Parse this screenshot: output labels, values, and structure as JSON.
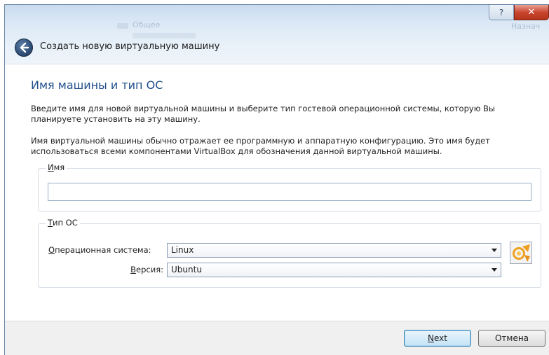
{
  "window": {
    "title": "Создать новую виртуальную машину",
    "help_label": "?",
    "close_label": "✕"
  },
  "background_hints": {
    "left_item": "Общее",
    "right_item": "Назнач"
  },
  "page": {
    "heading": "Имя машины и тип ОС",
    "intro": "Введите имя для новой виртуальной машины и выберите тип гостевой операционной системы, которую Вы планируете установить на эту машину.",
    "note": "Имя виртуальной машины обычно отражает ее программную и аппаратную конфигурацию. Это имя будет использоваться всеми компонентами VirtualBox для обозначения данной виртуальной машины."
  },
  "name_group": {
    "label_mnemonic": "И",
    "label_rest": "мя",
    "value": ""
  },
  "os_group": {
    "label_mnemonic": "Т",
    "label_rest": "ип ОС",
    "os_label_mnemonic": "О",
    "os_label_rest": "перационная система:",
    "os_value": "Linux",
    "version_label_mnemonic": "В",
    "version_label_rest": "ерсия:",
    "version_value": "Ubuntu",
    "os_icon": "ubuntu-os-icon"
  },
  "buttons": {
    "next_mnemonic": "N",
    "next_rest": "ext",
    "cancel_label": "Отмена"
  }
}
